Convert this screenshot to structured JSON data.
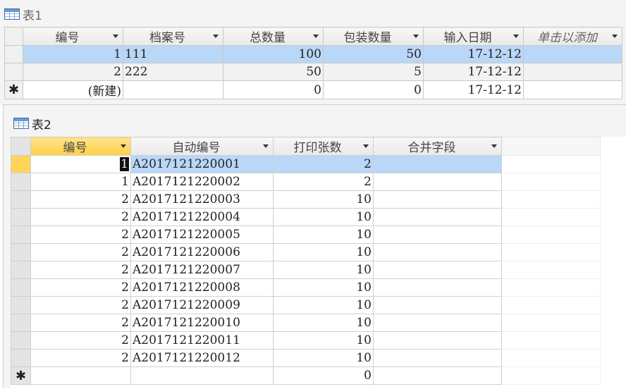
{
  "table1": {
    "title": "表1",
    "columns": [
      "编号",
      "档案号",
      "总数量",
      "包装数量",
      "输入日期",
      "单击以添加"
    ],
    "rows": [
      {
        "id": "1",
        "archive": "111",
        "total": "100",
        "pack": "50",
        "date": "17-12-12"
      },
      {
        "id": "2",
        "archive": "222",
        "total": "50",
        "pack": "5",
        "date": "17-12-12"
      },
      {
        "id": "(新建)",
        "archive": "",
        "total": "0",
        "pack": "0",
        "date": "17-12-12"
      }
    ],
    "new_marker": "✱"
  },
  "table2": {
    "title": "表2",
    "columns": [
      "编号",
      "自动编号",
      "打印张数",
      "合并字段"
    ],
    "rows": [
      {
        "id": "1",
        "auto": "A2017121220001",
        "count": "2",
        "merge": ""
      },
      {
        "id": "1",
        "auto": "A2017121220002",
        "count": "2",
        "merge": ""
      },
      {
        "id": "2",
        "auto": "A2017121220003",
        "count": "10",
        "merge": ""
      },
      {
        "id": "2",
        "auto": "A2017121220004",
        "count": "10",
        "merge": ""
      },
      {
        "id": "2",
        "auto": "A2017121220005",
        "count": "10",
        "merge": ""
      },
      {
        "id": "2",
        "auto": "A2017121220006",
        "count": "10",
        "merge": ""
      },
      {
        "id": "2",
        "auto": "A2017121220007",
        "count": "10",
        "merge": ""
      },
      {
        "id": "2",
        "auto": "A2017121220008",
        "count": "10",
        "merge": ""
      },
      {
        "id": "2",
        "auto": "A2017121220009",
        "count": "10",
        "merge": ""
      },
      {
        "id": "2",
        "auto": "A2017121220010",
        "count": "10",
        "merge": ""
      },
      {
        "id": "2",
        "auto": "A2017121220011",
        "count": "10",
        "merge": ""
      },
      {
        "id": "2",
        "auto": "A2017121220012",
        "count": "10",
        "merge": ""
      }
    ],
    "new_row_count": "0",
    "new_marker": "✱"
  },
  "colors": {
    "selected_row": "#b9d7f7",
    "active_header": "#ffcf4a"
  }
}
